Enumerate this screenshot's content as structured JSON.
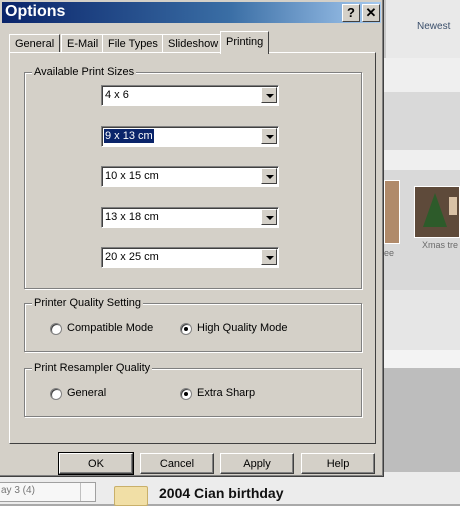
{
  "background": {
    "newest_label": "Newest",
    "photo_captions": [
      "ee",
      "Xmas tre"
    ],
    "filter_combo_value": "ay 3 (4)",
    "folder_title": "2004 Cian birthday"
  },
  "dialog": {
    "title": "Options",
    "help_button": "?",
    "close_button": "✕",
    "tabs": [
      {
        "label": "General"
      },
      {
        "label": "E-Mail"
      },
      {
        "label": "File Types"
      },
      {
        "label": "Slideshow"
      },
      {
        "label": "Printing",
        "active": true
      }
    ],
    "print_sizes": {
      "label": "Available Print Sizes",
      "values": [
        "4 x 6",
        "9 x 13 cm",
        "10 x 15 cm",
        "13 x 18 cm",
        "20 x 25 cm"
      ],
      "focused_index": 1
    },
    "printer_quality": {
      "label": "Printer Quality Setting",
      "options": [
        "Compatible Mode",
        "High Quality Mode"
      ],
      "selected": "High Quality Mode"
    },
    "resampler_quality": {
      "label": "Print Resampler Quality",
      "options": [
        "General",
        "Extra Sharp"
      ],
      "selected": "Extra Sharp"
    },
    "buttons": {
      "ok": "OK",
      "cancel": "Cancel",
      "apply": "Apply",
      "help": "Help"
    }
  }
}
